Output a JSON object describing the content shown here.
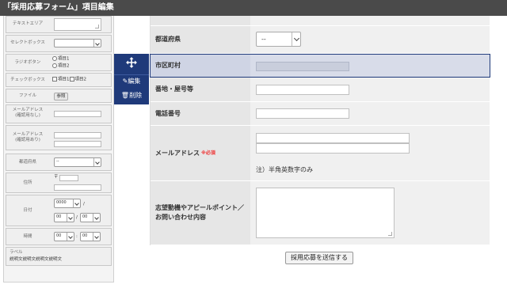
{
  "title": "「採用応募フォーム」項目編集",
  "sidebar": {
    "textarea_label": "テキストエリア",
    "select_label": "セレクトボックス",
    "radio_label": "ラジオボタン",
    "radio_options": [
      "項目1",
      "項目2"
    ],
    "checkbox_label": "チェックボックス",
    "checkbox_options": [
      "項目1",
      "項目2"
    ],
    "file_label": "ファイル",
    "file_button": "参照",
    "email1_label_a": "メールアドレス",
    "email1_label_b": "(確認用なし)",
    "email2_label_a": "メールアドレス",
    "email2_label_b": "(確認用あり)",
    "pref_label": "都道府県",
    "pref_value": "--",
    "address_label": "住所",
    "zip_mark": "〒",
    "date_label": "日付",
    "date_year": "0000",
    "date_sep": "/",
    "date_month": "00",
    "date_day": "00",
    "time_label": "時間",
    "time_hour": "00",
    "time_sep": ":",
    "time_min": "00",
    "label_label": "ラベル",
    "label_text": "説明文説明文説明文説明文"
  },
  "toolbar": {
    "edit": "編集",
    "delete": "削除"
  },
  "form": {
    "pref_label": "都道府県",
    "pref_value": "--",
    "city_label": "市区町村",
    "addr_label": "番地・屋号等",
    "phone_label": "電話番号",
    "email_label": "メールアドレス",
    "email_required": "※必須",
    "email_note": "注）半角英数字のみ",
    "message_label": "志望動機やアピールポイント／お問い合わせ内容",
    "submit": "採用応募を送信する"
  }
}
